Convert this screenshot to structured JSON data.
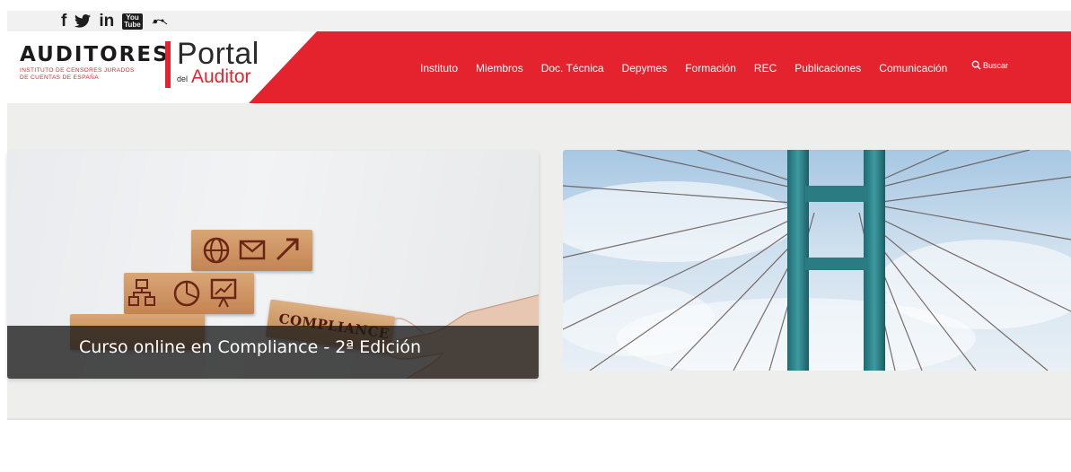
{
  "social": {
    "icons": [
      "facebook-icon",
      "twitter-icon",
      "linkedin-icon",
      "youtube-icon",
      "flickr-icon"
    ],
    "facebook": "f",
    "linkedin": "in",
    "youtube_top": "You",
    "youtube_bottom": "Tube"
  },
  "header": {
    "logo_main": "AUDITORES",
    "logo_sub_line1": "Instituto de Censores Jurados",
    "logo_sub_line2": "de Cuentas de España",
    "portal_title": "Portal",
    "portal_del": "del",
    "portal_auditor": "Auditor",
    "nav": [
      {
        "label": "Instituto"
      },
      {
        "label": "Miembros"
      },
      {
        "label": "Doc. Técnica"
      },
      {
        "label": "Depymes"
      },
      {
        "label": "Formación"
      },
      {
        "label": "REC"
      },
      {
        "label": "Publicaciones"
      },
      {
        "label": "Comunicación"
      }
    ],
    "search_label": "Buscar"
  },
  "hero": {
    "slides": [
      {
        "caption": "Curso online en Compliance - 2ª Edición",
        "block_text": "COMPLIANCE"
      },
      {
        "caption": ""
      }
    ]
  },
  "colors": {
    "brand_red": "#e4232e",
    "hero_bg": "#eeeeec"
  }
}
